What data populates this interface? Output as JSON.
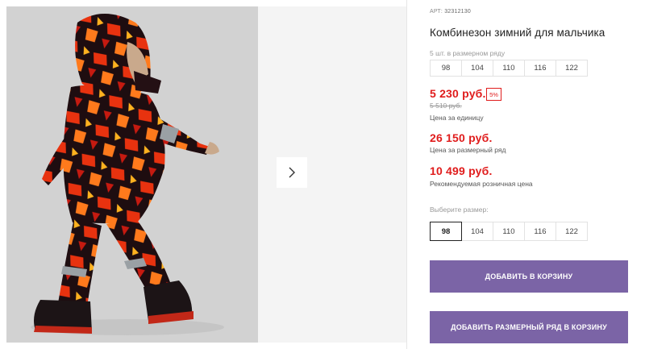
{
  "product": {
    "sku_label": "АРТ:",
    "sku_value": "32312130",
    "title": "Комбинезон зимний для мальчика"
  },
  "pack": {
    "caption": "5 шт. в размерном ряду",
    "sizes": [
      "98",
      "104",
      "110",
      "116",
      "122"
    ]
  },
  "pricing": {
    "unit_price": "5 230 руб.",
    "discount": "5%",
    "old_price": "5 510 руб.",
    "unit_caption": "Цена за единицу",
    "pack_price": "26 150 руб.",
    "pack_caption": "Цена за размерный ряд",
    "retail_price": "10 499 руб.",
    "retail_caption": "Рекомендуемая розничная цена"
  },
  "size_selector": {
    "caption": "Выберите размер:",
    "sizes": [
      "98",
      "104",
      "110",
      "116",
      "122"
    ],
    "selected": "98"
  },
  "actions": {
    "add_to_cart": "ДОБАВИТЬ В КОРЗИНУ",
    "add_pack_to_cart": "ДОБАВИТЬ РАЗМЕРНЫЙ РЯД В КОРЗИНУ"
  },
  "colors": {
    "accent": "#7b64a6",
    "price_red": "#e01c1c"
  },
  "icons": {
    "next": "chevron-right-icon"
  }
}
